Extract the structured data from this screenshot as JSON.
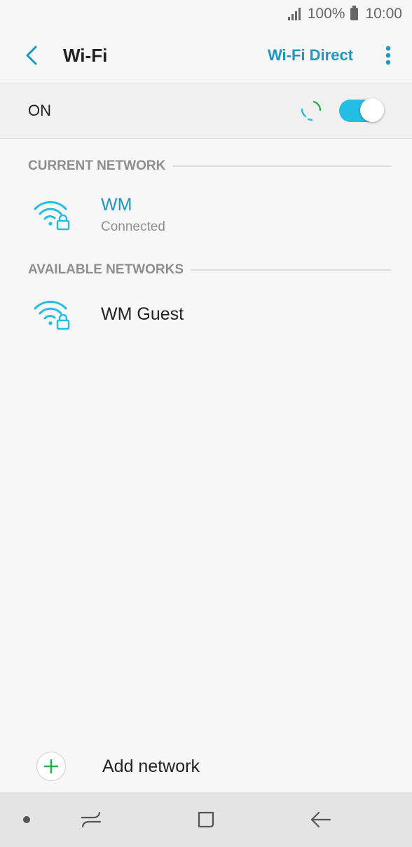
{
  "status_bar": {
    "battery": "100%",
    "time": "10:00"
  },
  "app_bar": {
    "title": "Wi-Fi",
    "action": "Wi-Fi Direct"
  },
  "wifi_toggle": {
    "label": "ON",
    "state": "on"
  },
  "sections": {
    "current": "CURRENT NETWORK",
    "available": "AVAILABLE NETWORKS"
  },
  "networks": {
    "current": {
      "name": "WM",
      "status": "Connected"
    },
    "available": [
      {
        "name": "WM Guest"
      }
    ]
  },
  "add_network": {
    "label": "Add network"
  },
  "colors": {
    "accent": "#1b97c2",
    "switch": "#23bde6",
    "add": "#22b14c"
  },
  "icons": [
    "back-arrow-icon",
    "more-vert-icon",
    "wifi-lock-icon",
    "plus-icon",
    "recent-apps-icon",
    "home-icon",
    "nav-back-icon"
  ]
}
